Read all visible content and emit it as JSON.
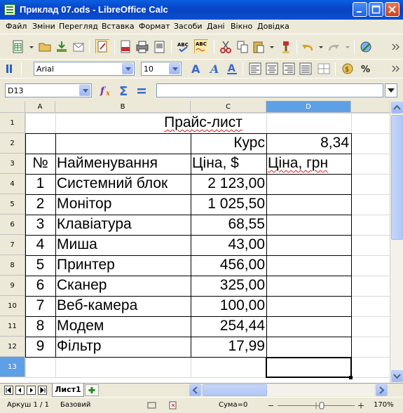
{
  "window": {
    "title": "Приклад 07.ods - LibreOffice Calc"
  },
  "menu": [
    "Файл",
    "Зміни",
    "Перегляд",
    "Вставка",
    "Формат",
    "Засоби",
    "Дані",
    "Вікно",
    "Довідка"
  ],
  "format_toolbar": {
    "font_name": "Arial",
    "font_size": "10"
  },
  "formula_bar": {
    "name_box": "D13",
    "formula": ""
  },
  "columns": [
    "A",
    "B",
    "C",
    "D"
  ],
  "rows": [
    "1",
    "2",
    "3",
    "4",
    "5",
    "6",
    "7",
    "8",
    "9",
    "10",
    "11",
    "12",
    "13"
  ],
  "sheet": {
    "title": "Прайс-лист",
    "rate_label": "Курс",
    "rate_value": "8,34",
    "headers": {
      "num": "№",
      "name": "Найменування",
      "price_usd": "Ціна, $",
      "price_uah": "Ціна, грн"
    },
    "items": [
      {
        "num": "1",
        "name": "Системний блок",
        "price": "2 123,00"
      },
      {
        "num": "2",
        "name": "Монітор",
        "price": "1 025,50"
      },
      {
        "num": "3",
        "name": "Клавіатура",
        "price": "68,55"
      },
      {
        "num": "4",
        "name": "Миша",
        "price": "43,00"
      },
      {
        "num": "5",
        "name": "Принтер",
        "price": "456,00"
      },
      {
        "num": "6",
        "name": "Сканер",
        "price": "325,00"
      },
      {
        "num": "7",
        "name": "Веб-камера",
        "price": "100,00"
      },
      {
        "num": "8",
        "name": "Модем",
        "price": "254,44"
      },
      {
        "num": "9",
        "name": "Фільтр",
        "price": "17,99"
      }
    ]
  },
  "tabs": {
    "active": "Лист1"
  },
  "status": {
    "sheet": "Аркуш 1 / 1",
    "style": "Базовий",
    "sum": "Сума=0",
    "zoom": "170%"
  }
}
